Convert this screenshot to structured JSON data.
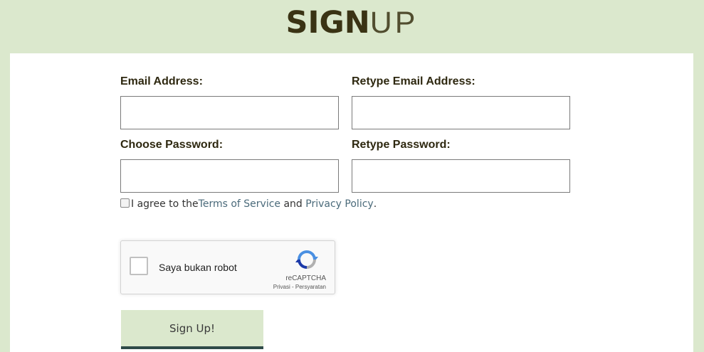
{
  "header": {
    "title_bold": "SIGN",
    "title_thin": "UP"
  },
  "form": {
    "email_label": "Email Address:",
    "retype_email_label": "Retype Email Address:",
    "password_label": "Choose Password:",
    "retype_password_label": "Retype Password:",
    "email_value": "",
    "retype_email_value": "",
    "password_value": "",
    "retype_password_value": ""
  },
  "agreement": {
    "prefix": "I agree to the ",
    "terms_link": "Terms of Service",
    "middle": " and ",
    "privacy_link": "Privacy Policy",
    "suffix": ".",
    "checked": false
  },
  "recaptcha": {
    "label": "Saya bukan robot",
    "brand": "reCAPTCHA",
    "links": "Privasi - Persyaratan",
    "icon": "recaptcha-logo-icon"
  },
  "submit": {
    "label": "Sign Up!"
  },
  "colors": {
    "page_bg": "#dbe8cd",
    "title": "#3a3314",
    "button_bg": "#dbe8cd",
    "button_border": "#2f4a48",
    "link": "#4a6a7a"
  }
}
